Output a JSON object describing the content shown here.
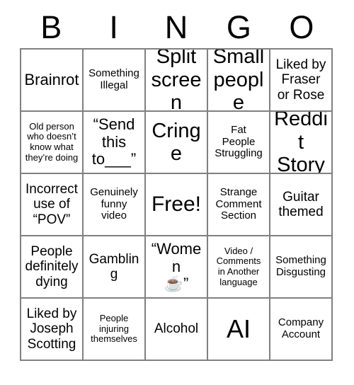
{
  "card": {
    "title": "BINGO Card",
    "header_letters": [
      "B",
      "I",
      "N",
      "G",
      "O"
    ],
    "border_color": "#808080",
    "background_color": "#ffffff",
    "text_color": "#000000",
    "grid_size": "5x5",
    "rows": [
      [
        {
          "text": "Brainrot",
          "size": "lg"
        },
        {
          "text": "Something\nIllegal",
          "size": "sm"
        },
        {
          "text": "Split\nscreen",
          "size": "xl"
        },
        {
          "text": "Small\npeople",
          "size": "xl"
        },
        {
          "text": "Liked by\nFraser\nor Rose",
          "size": "md"
        }
      ],
      [
        {
          "text": "Old person\nwho doesn’t\nknow what\nthey’re doing",
          "size": "xs"
        },
        {
          "text": "“Send\nthis\nto___”",
          "size": "lg"
        },
        {
          "text": "Cringe",
          "size": "xl"
        },
        {
          "text": "Fat\nPeople\nStruggling",
          "size": "sm"
        },
        {
          "text": "Reddit\nStory",
          "size": "xl"
        }
      ],
      [
        {
          "text": "Incorrect\nuse of\n“POV”",
          "size": "md"
        },
        {
          "text": "Genuinely\nfunny\nvideo",
          "size": "sm"
        },
        {
          "text": "Free!",
          "size": "free"
        },
        {
          "text": "Strange\nComment\nSection",
          "size": "sm"
        },
        {
          "text": "Guitar\nthemed",
          "size": "md"
        }
      ],
      [
        {
          "text": "People\ndefinitely\ndying",
          "size": "md"
        },
        {
          "text": "Gambling",
          "size": "md"
        },
        {
          "text": "“Women\n☕”",
          "size": "lg",
          "emoji": "☕"
        },
        {
          "text": "Video /\nComments\nin Another\nlanguage",
          "size": "xs"
        },
        {
          "text": "Something\nDisgusting",
          "size": "sm"
        }
      ],
      [
        {
          "text": "Liked by\nJoseph\nScotting",
          "size": "md"
        },
        {
          "text": "People\ninjuring\nthemselves",
          "size": "xs"
        },
        {
          "text": "Alcohol",
          "size": "md"
        },
        {
          "text": "AI",
          "size": "huge"
        },
        {
          "text": "Company\nAccount",
          "size": "sm"
        }
      ]
    ]
  }
}
